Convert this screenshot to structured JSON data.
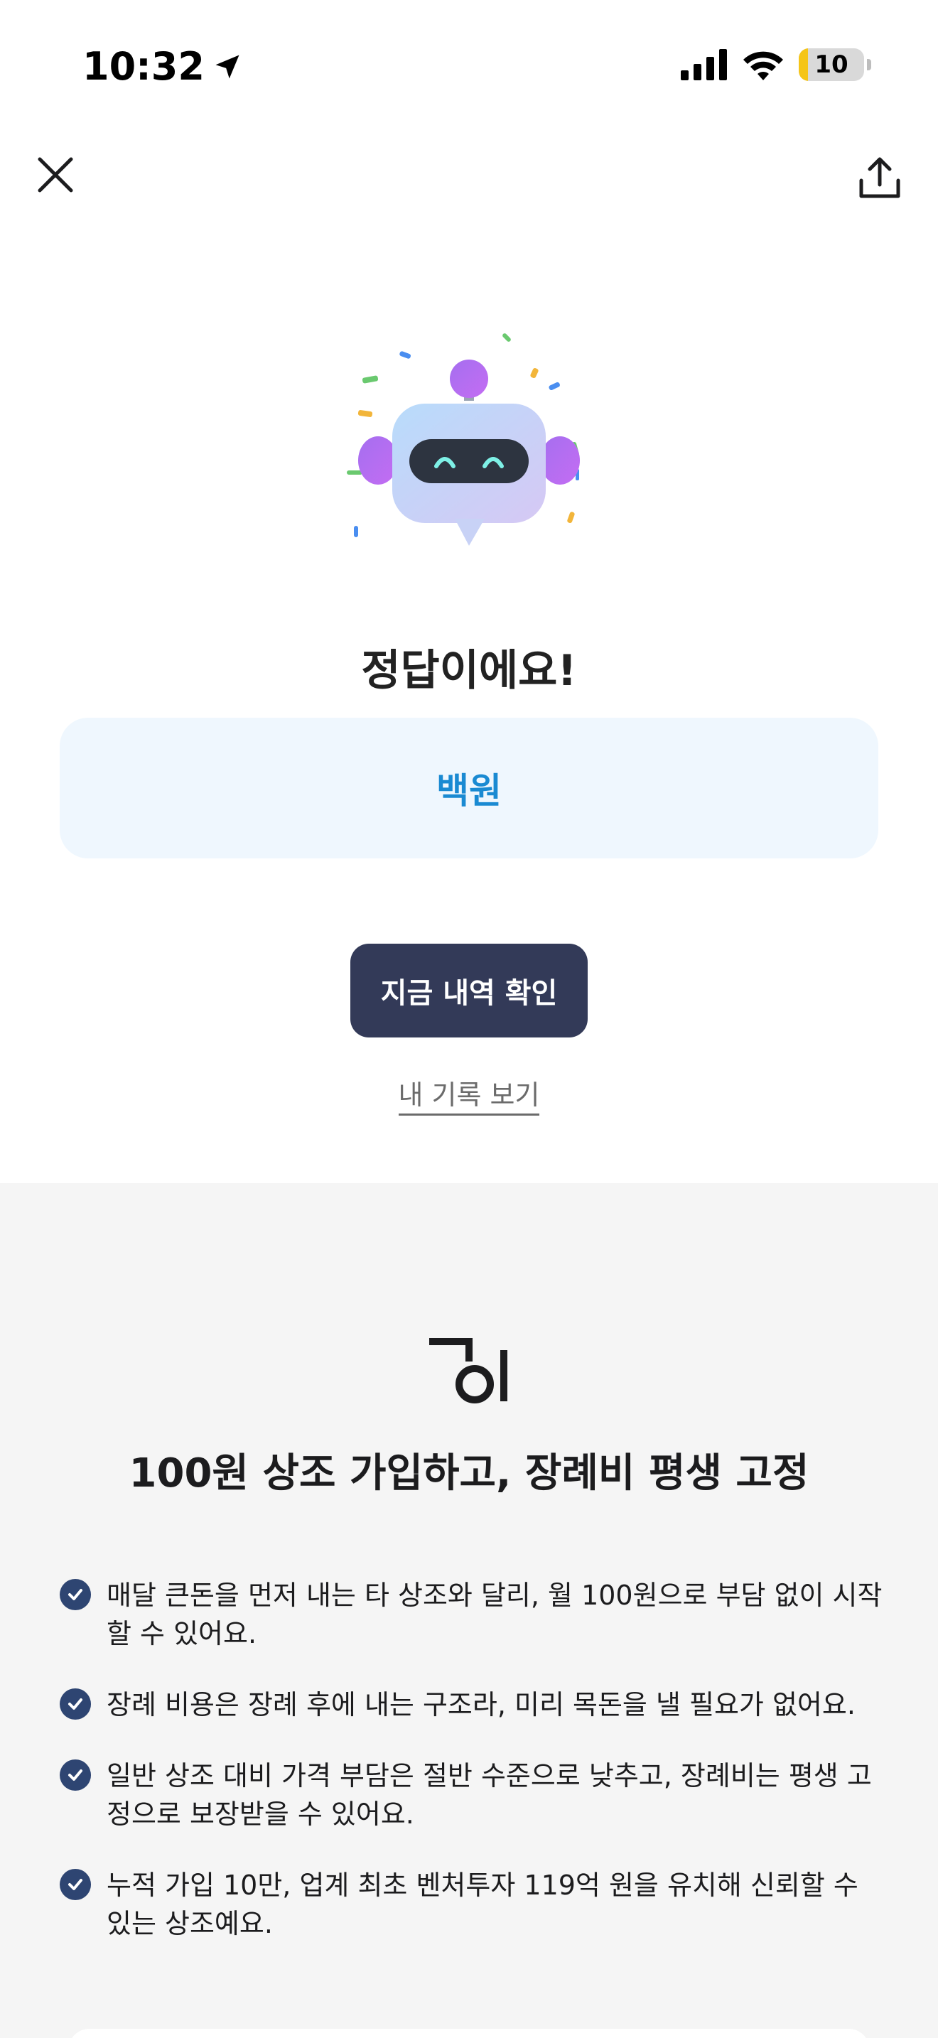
{
  "status_bar": {
    "time": "10:32",
    "battery_level": "10",
    "location_icon": "location-arrow-icon",
    "signal_icon": "cellular-signal-icon",
    "wifi_icon": "wifi-icon"
  },
  "nav": {
    "close_icon": "close-icon",
    "share_icon": "share-icon"
  },
  "result": {
    "title": "정답이에요!",
    "answer": "백원",
    "primary_button": "지금 내역 확인",
    "secondary_link": "내 기록 보기"
  },
  "promo": {
    "title": "100원 상조 가입하고, 장례비 평생 고정",
    "benefits": [
      "매달 큰돈을 먼저 내는 타 상조와 달리, 월 100원으로 부담 없이 시작할 수 있어요.",
      "장례 비용은 장례 후에 내는 구조라, 미리 목돈을 낼 필요가 없어요.",
      "일반 상조 대비 가격 부담은 절반 수준으로 낮추고, 장례비는 평생 고정으로 보장받을 수 있어요.",
      "누적 가입 10만, 업계 최초 벤처투자 119억 원을 유치해 신뢰할 수 있는 상조예요."
    ]
  },
  "colors": {
    "accent_blue": "#1a8ad2",
    "answer_bg": "#eff7fe",
    "button_bg": "#333a58",
    "check_bg": "#2e4572",
    "promo_bg": "#f5f5f5"
  }
}
